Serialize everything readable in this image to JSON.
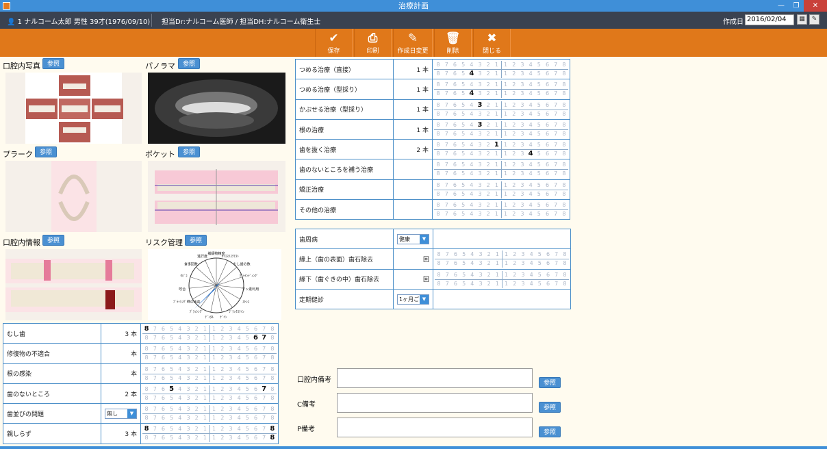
{
  "window": {
    "title": "治療計画"
  },
  "patient": {
    "name": "1 ナルコーム太郎 男性 39才(1976/09/10)",
    "staff": "担当Dr:ナルコーム医師 / 担当DH:ナルコーム衛生士",
    "date_label": "作成日",
    "date_value": "2016/02/04"
  },
  "toolbar": {
    "save": "保存",
    "print": "印刷",
    "change_date": "作成日変更",
    "delete": "削除",
    "close": "閉じる"
  },
  "sections": {
    "intraoral_photo": "口腔内写真",
    "panorama": "パノラマ",
    "plaque": "プラーク",
    "pocket": "ポケット",
    "oral_info": "口腔内情報",
    "risk": "リスク管理",
    "ref": "参照"
  },
  "tooth_numbers": {
    "left": [
      "8",
      "7",
      "6",
      "5",
      "4",
      "3",
      "2",
      "1"
    ],
    "right": [
      "1",
      "2",
      "3",
      "4",
      "5",
      "6",
      "7",
      "8"
    ]
  },
  "left_table": [
    {
      "label": "むし歯",
      "count": "3 本",
      "top_on": [
        "L8"
      ],
      "bot_on": [
        "R6",
        "R7"
      ]
    },
    {
      "label": "修復物の不適合",
      "count": "本",
      "top_on": [],
      "bot_on": []
    },
    {
      "label": "根の感染",
      "count": "本",
      "top_on": [],
      "bot_on": []
    },
    {
      "label": "歯のないところ",
      "count": "2 本",
      "top_on": [
        "L5",
        "R7"
      ],
      "bot_on": []
    },
    {
      "label": "歯並びの問題",
      "select": "無し",
      "top_on": [],
      "bot_on": []
    },
    {
      "label": "親しらず",
      "count": "3 本",
      "top_on": [
        "L8",
        "R8"
      ],
      "bot_on": [
        "R8"
      ]
    }
  ],
  "right_table": [
    {
      "label": "つめる治療（直接）",
      "count": "1 本",
      "top_on": [],
      "bot_on": [
        "L4"
      ]
    },
    {
      "label": "つめる治療（型採り）",
      "count": "1 本",
      "top_on": [],
      "bot_on": [
        "L4"
      ]
    },
    {
      "label": "かぶせる治療（型採り）",
      "count": "1 本",
      "top_on": [
        "L3"
      ],
      "bot_on": []
    },
    {
      "label": "根の治療",
      "count": "1 本",
      "top_on": [
        "L3"
      ],
      "bot_on": []
    },
    {
      "label": "歯を抜く治療",
      "count": "2 本",
      "top_on": [
        "L1"
      ],
      "bot_on": [
        "R4"
      ]
    },
    {
      "label": "歯のないところを補う治療",
      "count": "",
      "top_on": [],
      "bot_on": []
    },
    {
      "label": "矯正治療",
      "count": "",
      "top_on": [],
      "bot_on": []
    },
    {
      "label": "その他の治療",
      "count": "",
      "top_on": [],
      "bot_on": []
    }
  ],
  "perio_table": [
    {
      "label": "歯周病",
      "select": "健康"
    },
    {
      "label": "縁上（歯の表面）歯石除去",
      "count": "回"
    },
    {
      "label": "縁下（歯ぐきの中）歯石除去",
      "count": "回"
    },
    {
      "label": "定期健診",
      "select": "1ヶ月ご"
    }
  ],
  "notes": {
    "oral": "口腔内備考",
    "c": "C備考",
    "p": "P備考"
  },
  "risk_chart": {
    "labels": [
      "補綴物精度",
      "ｶﾘｴｽﾘｽｸﾃｽﾄ",
      "むし歯の数",
      "ｸﾞﾗｲﾝﾃﾞｨﾝｸﾞ",
      "フッ素利用",
      "ｽﾄﾚｽ",
      "ﾌﾞﾗｯｸｽﾃｲﾝ",
      "ｹﾞｲﾝ",
      "ﾃﾞﾝﾀﾙ",
      "ﾌﾞﾗｯｼﾝｸﾞ",
      "ﾌﾞﾗｯｼﾝｸﾞ時の出血",
      "咬合",
      "ﾀﾊﾞｺ",
      "食事回数",
      "進行度"
    ]
  }
}
